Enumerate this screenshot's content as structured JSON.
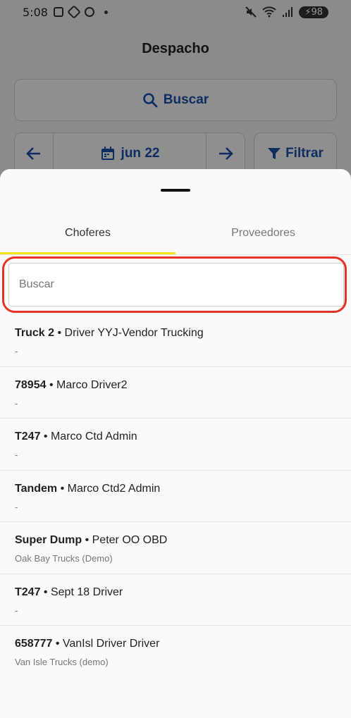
{
  "status_bar": {
    "time": "5:08",
    "battery": "98"
  },
  "appbar": {
    "title": "Despacho"
  },
  "background": {
    "search_label": "Buscar",
    "date_label": "jun 22",
    "filter_label": "Filtrar"
  },
  "sheet": {
    "tabs": [
      {
        "label": "Choferes",
        "active": true
      },
      {
        "label": "Proveedores",
        "active": false
      }
    ],
    "search": {
      "placeholder": "Buscar",
      "value": ""
    },
    "items": [
      {
        "unit": "Truck 2",
        "separator": " • ",
        "driver": "Driver YYJ-Vendor Trucking",
        "company": "-"
      },
      {
        "unit": "78954",
        "separator": " • ",
        "driver": "Marco Driver2",
        "company": "-"
      },
      {
        "unit": "T247",
        "separator": " • ",
        "driver": "Marco Ctd Admin",
        "company": "-"
      },
      {
        "unit": "Tandem",
        "separator": " • ",
        "driver": "Marco Ctd2 Admin",
        "company": "-"
      },
      {
        "unit": "Super Dump",
        "separator": " • ",
        "driver": "Peter OO OBD",
        "company": "Oak Bay Trucks (Demo)"
      },
      {
        "unit": "T247",
        "separator": " • ",
        "driver": "Sept 18 Driver",
        "company": "-"
      },
      {
        "unit": "658777",
        "separator": " • ",
        "driver": "VanIsl Driver Driver",
        "company": "Van Isle Trucks (demo)"
      }
    ]
  },
  "colors": {
    "accent": "#1a4fa6",
    "tab_indicator": "#f5e61a",
    "highlight": "#e63325"
  }
}
